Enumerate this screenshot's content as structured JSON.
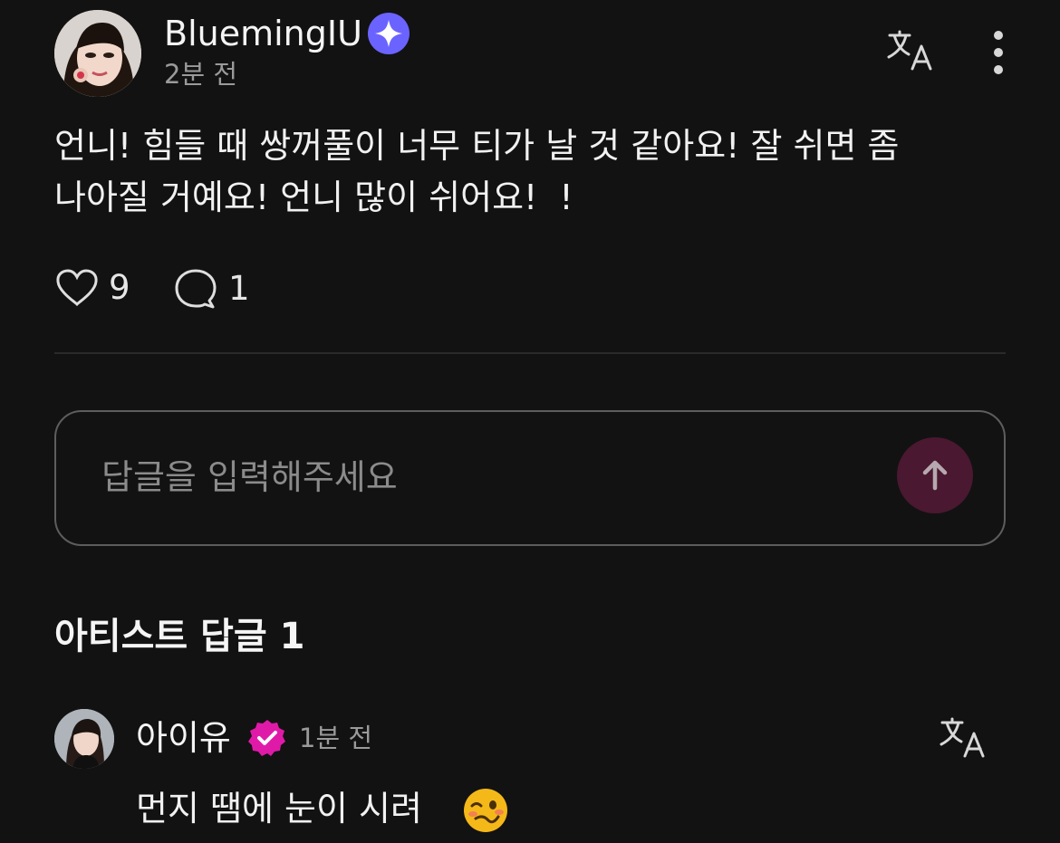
{
  "post": {
    "author": "BluemingIU",
    "time": "2분 전",
    "body": "언니! 힘들 때 쌍꺼풀이 너무 티가 날 것 같아요! 잘 쉬면 좀\n나아질 거예요! 언니 많이 쉬어요!  !",
    "likes": "9",
    "comments": "1",
    "avatar_icon": "user-avatar-photo",
    "badge_icon": "sparkle-verified-badge"
  },
  "reply_input": {
    "placeholder": "답글을 입력해주세요",
    "value": "",
    "send_icon": "arrow-up-icon"
  },
  "artist_replies": {
    "title": "아티스트 답글 1",
    "items": [
      {
        "author": "아이유",
        "time": "1분 전",
        "text": "먼지 땜에 눈이 시려",
        "emoji": "woozy-face-emoji",
        "badge_icon": "pink-verified-check-badge"
      }
    ]
  },
  "colors": {
    "background": "#121212",
    "text_primary": "#f2f2f2",
    "text_secondary": "#9a9a9a",
    "divider": "#2a2a2a",
    "input_border": "#5d5d5d",
    "send_button": "#4a1830",
    "verified_blue": "#6b63ff",
    "verified_pink": "#e01aa8"
  }
}
